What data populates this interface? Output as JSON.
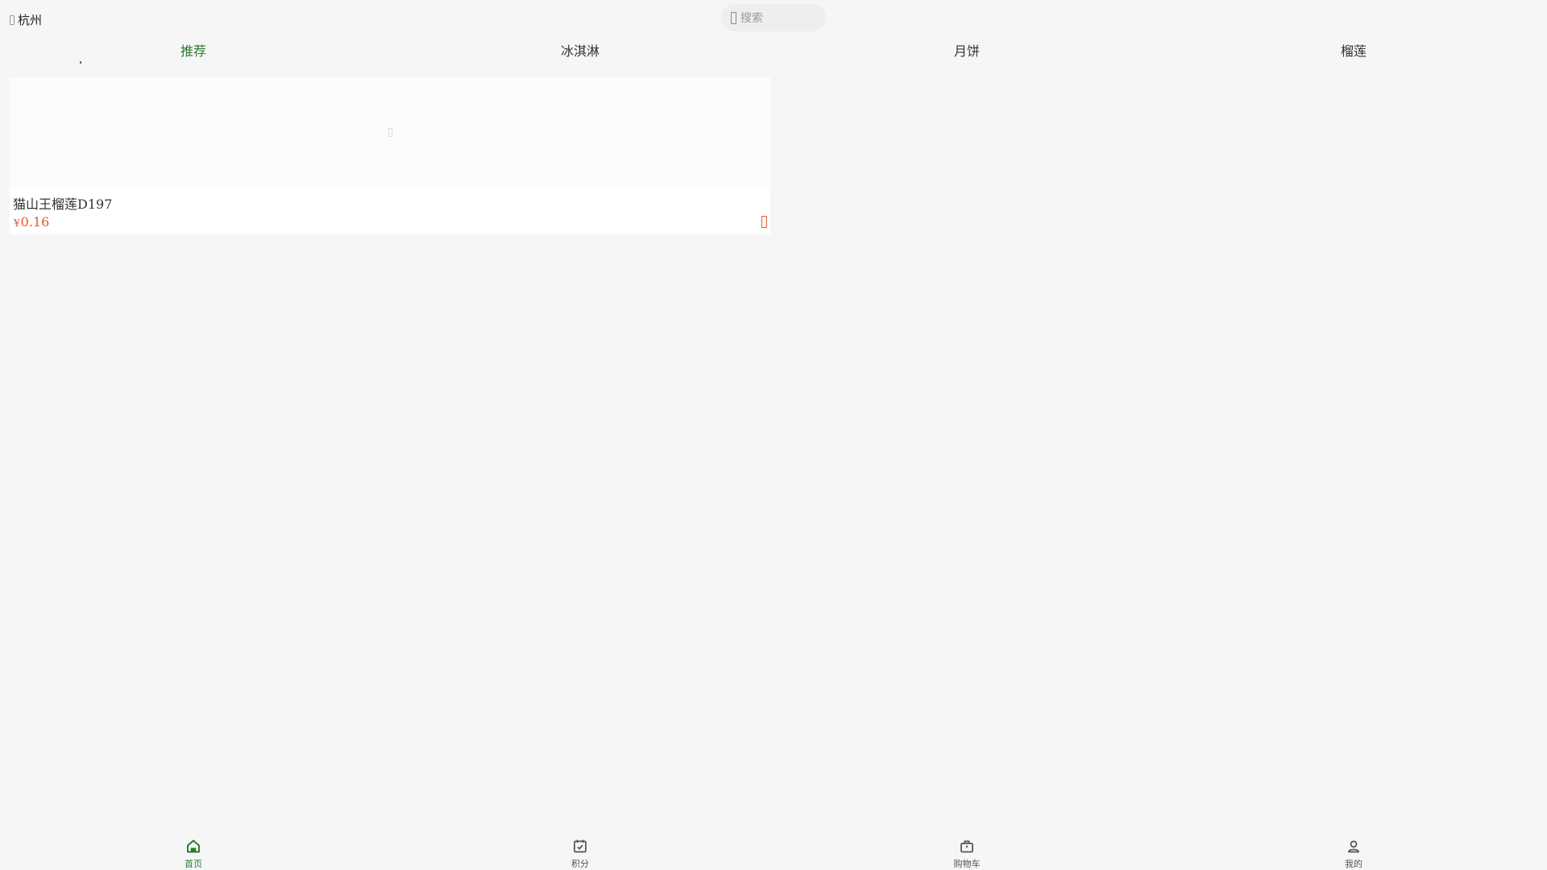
{
  "header": {
    "location": "杭州",
    "search_placeholder": "搜索"
  },
  "tabs": [
    {
      "label": "推荐",
      "active": true
    },
    {
      "label": "冰淇淋",
      "active": false
    },
    {
      "label": "月饼",
      "active": false
    },
    {
      "label": "榴莲",
      "active": false
    }
  ],
  "products": [
    {
      "name": "猫山王榴莲D197",
      "currency": "¥",
      "price": "0.16"
    }
  ],
  "bottom_nav": [
    {
      "label": "首页",
      "icon": "home-icon",
      "active": true
    },
    {
      "label": "积分",
      "icon": "calendar-check-icon",
      "active": false
    },
    {
      "label": "购物车",
      "icon": "bag-icon",
      "active": false
    },
    {
      "label": "我的",
      "icon": "user-icon",
      "active": false
    }
  ],
  "colors": {
    "accent": "#2a7a2f",
    "price": "#e8562a",
    "background": "#f6f6f6"
  }
}
